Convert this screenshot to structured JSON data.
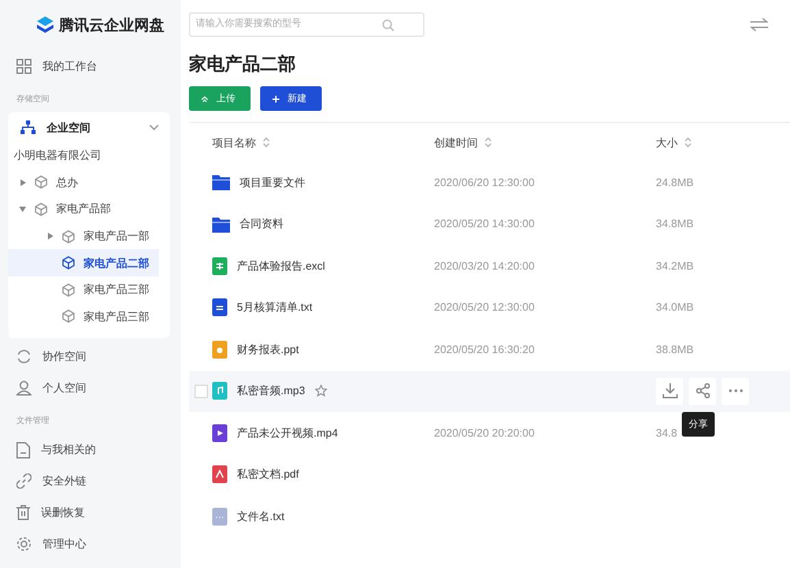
{
  "sidebar": {
    "logo": "腾讯云企业网盘",
    "workbench": "我的工作台",
    "storage_label": "存储空间",
    "enterprise": {
      "label": "企业空间",
      "expanded": true
    },
    "tree": [
      {
        "label": "小明电器有限公司",
        "selected": false,
        "children": [
          {
            "label": "总办",
            "selected": false,
            "expanded": false
          },
          {
            "label": "家电产品部",
            "selected": false,
            "expanded": true,
            "children": [
              {
                "label": "家电产品一部",
                "selected": false,
                "expanded": false
              },
              {
                "label": "家电产品二部",
                "selected": true
              },
              {
                "label": "家电产品三部",
                "selected": false
              },
              {
                "label": "家电产品三部",
                "selected": false
              }
            ]
          }
        ]
      }
    ],
    "spaces": [
      {
        "label": "协作空间",
        "kind": "sync"
      },
      {
        "label": "个人空间",
        "kind": "person"
      }
    ],
    "files_label": "文件管理",
    "files": [
      {
        "label": "与我相关的",
        "kind": "doc"
      },
      {
        "label": "安全外链",
        "kind": "link"
      },
      {
        "label": "误删恢复",
        "kind": "trash"
      },
      {
        "label": "管理中心",
        "kind": "gear"
      }
    ]
  },
  "search": {
    "placeholder": "请输入你需要搜索的型号"
  },
  "title": "家电产品二部",
  "buttons": [
    {
      "label": "上传",
      "kind": "upload"
    },
    {
      "label": "新建",
      "kind": "new"
    }
  ],
  "table": {
    "columns": [
      "项目名称",
      "创建时间",
      "大小"
    ],
    "rows": [
      {
        "kind": "folder",
        "name": "项目重要文件",
        "created": "2020/06/20 12:30:00",
        "size": "24.8MB",
        "hovered": false
      },
      {
        "kind": "folder",
        "name": "合同资料",
        "created": "2020/05/20 14:30:00",
        "size": "34.8MB",
        "hovered": false
      },
      {
        "kind": "excel",
        "name": "产品体验报告.excl",
        "created": "2020/03/20 14:20:00",
        "size": "34.2MB",
        "hovered": false
      },
      {
        "kind": "txt",
        "name": "5月核算清单.txt",
        "created": "2020/05/20 12:30:00",
        "size": "34.0MB",
        "hovered": false
      },
      {
        "kind": "ppt",
        "name": "财务报表.ppt",
        "created": "2020/05/20 16:30:20",
        "size": "38.8MB",
        "hovered": false
      },
      {
        "kind": "audio",
        "name": "私密音频.mp3",
        "hovered": true,
        "checked": false
      },
      {
        "kind": "video",
        "name": "产品未公开视频.mp4",
        "created": "2020/05/20 20:20:00",
        "size": "34.8",
        "hovered": false
      },
      {
        "kind": "pdf",
        "name": "私密文档.pdf",
        "hovered": false
      },
      {
        "kind": "file",
        "name": "文件名.txt",
        "hovered": false
      }
    ]
  },
  "tooltip": {
    "text": "分享"
  }
}
